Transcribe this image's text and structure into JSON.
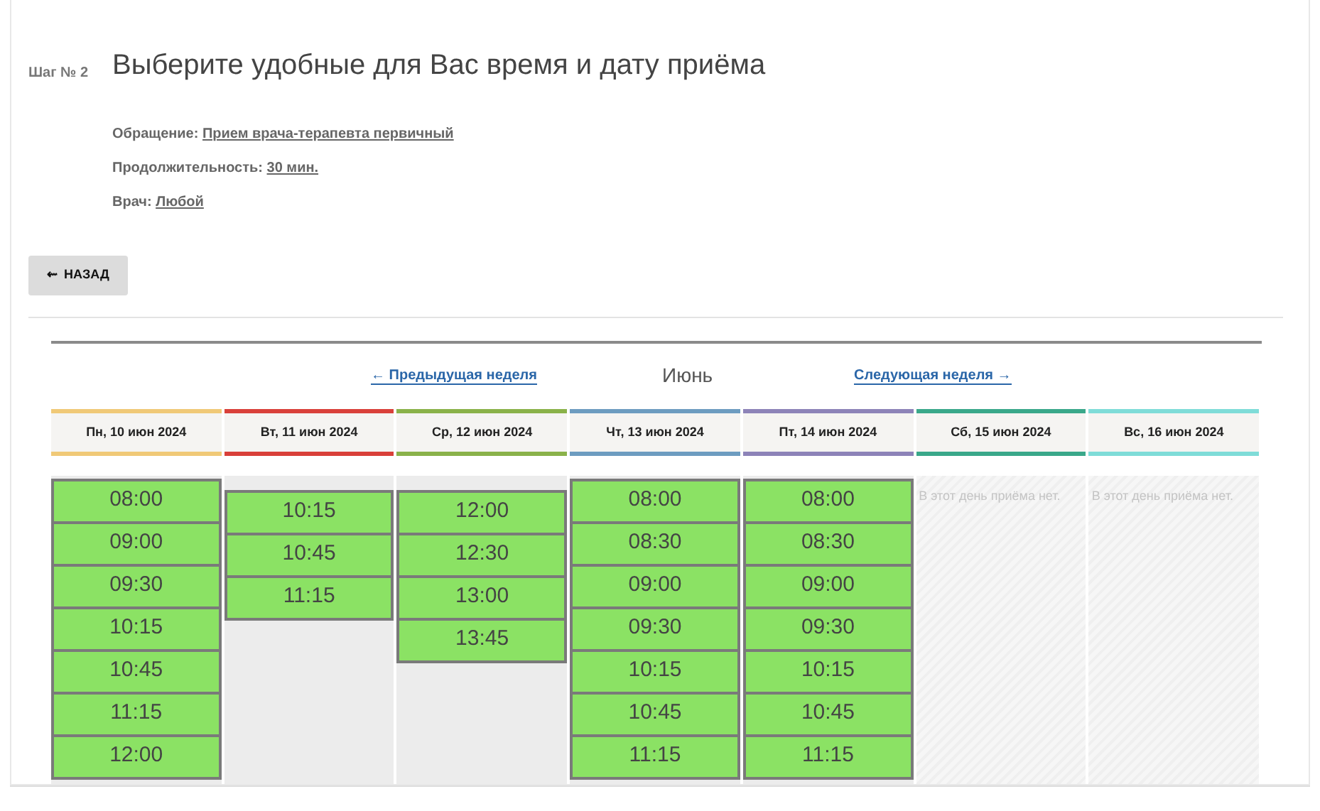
{
  "step": {
    "label": "Шаг № 2",
    "title": "Выберите удобные для Вас время и дату приёма"
  },
  "details": [
    {
      "label": "Обращение:",
      "value": "Прием врача-терапевта первичный"
    },
    {
      "label": "Продолжительность:",
      "value": "30 мин."
    },
    {
      "label": "Врач:",
      "value": "Любой"
    }
  ],
  "back_button": {
    "icon": "⇜",
    "label": "НАЗАД"
  },
  "week_nav": {
    "prev": "← Предыдущая неделя",
    "month": "Июнь",
    "next": "Следующая неделя →"
  },
  "days": [
    {
      "label": "Пн, 10 июн 2024",
      "color": "#f0c977",
      "kind": "slots",
      "offset": false,
      "slots": [
        "08:00",
        "09:00",
        "09:30",
        "10:15",
        "10:45",
        "11:15",
        "12:00"
      ]
    },
    {
      "label": "Вт, 11 июн 2024",
      "color": "#d9403a",
      "kind": "slots",
      "offset": true,
      "slots": [
        "10:15",
        "10:45",
        "11:15"
      ]
    },
    {
      "label": "Ср, 12 июн 2024",
      "color": "#8ab24a",
      "kind": "slots",
      "offset": true,
      "slots": [
        "12:00",
        "12:30",
        "13:00",
        "13:45"
      ]
    },
    {
      "label": "Чт, 13 июн 2024",
      "color": "#6d9cc0",
      "kind": "slots",
      "offset": false,
      "slots": [
        "08:00",
        "08:30",
        "09:00",
        "09:30",
        "10:15",
        "10:45",
        "11:15"
      ]
    },
    {
      "label": "Пт, 14 июн 2024",
      "color": "#8d83b8",
      "kind": "slots",
      "offset": false,
      "slots": [
        "08:00",
        "08:30",
        "09:00",
        "09:30",
        "10:15",
        "10:45",
        "11:15"
      ]
    },
    {
      "label": "Сб, 15 июн 2024",
      "color": "#3aa88a",
      "kind": "empty",
      "message": "В этот день приёма нет."
    },
    {
      "label": "Вс, 16 июн 2024",
      "color": "#7fdcd8",
      "kind": "empty",
      "message": "В этот день приёма нет."
    }
  ]
}
